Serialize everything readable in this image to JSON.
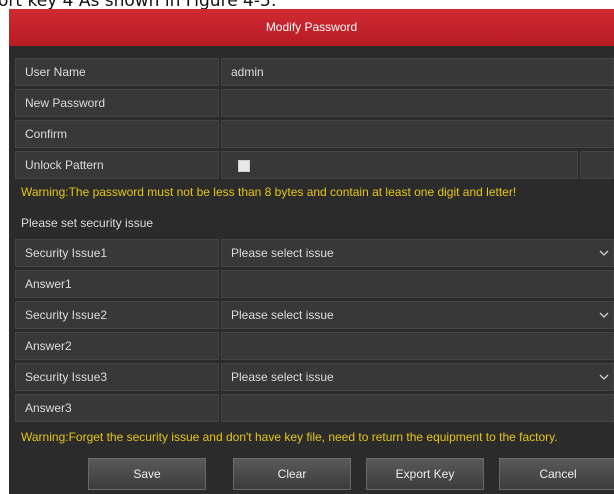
{
  "caption": {
    "left": "ort key 4 As shown in Figure 4-5:"
  },
  "dialog": {
    "title": "Modify Password",
    "user_name": {
      "label": "User Name",
      "value": "admin"
    },
    "new_password": {
      "label": "New Password",
      "value": ""
    },
    "confirm": {
      "label": "Confirm",
      "value": ""
    },
    "unlock_pattern": {
      "label": "Unlock Pattern",
      "checked": false
    },
    "warning_password": "Warning:The password must not be less than 8 bytes and contain at least one digit and letter!",
    "security_prompt": "Please set security issue",
    "security": [
      {
        "issue_label": "Security Issue1",
        "issue_value": "Please select issue",
        "answer_label": "Answer1",
        "answer_value": ""
      },
      {
        "issue_label": "Security Issue2",
        "issue_value": "Please select issue",
        "answer_label": "Answer2",
        "answer_value": ""
      },
      {
        "issue_label": "Security Issue3",
        "issue_value": "Please select issue",
        "answer_label": "Answer3",
        "answer_value": ""
      }
    ],
    "warning_forget": "Warning:Forget the security issue and don't have key file, need to return the equipment to the factory.",
    "buttons": {
      "save": "Save",
      "clear": "Clear",
      "export_key": "Export Key",
      "cancel": "Cancel"
    }
  },
  "colors": {
    "title_bar": "#c8232b",
    "panel": "#2b2b2b",
    "cell": "#383838",
    "warning": "#e6c619"
  },
  "icons": {
    "dropdown": "chevron-down-icon"
  }
}
